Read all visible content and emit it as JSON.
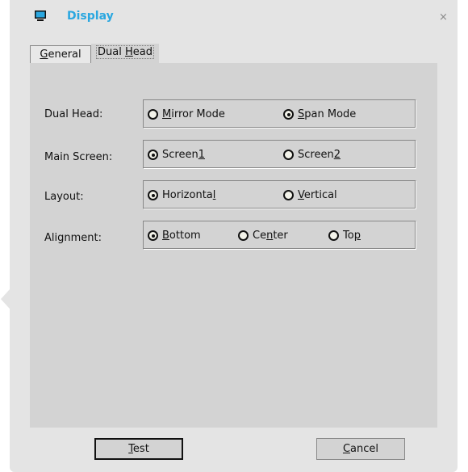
{
  "window": {
    "title": "Display",
    "icon": "monitor-icon",
    "close": "×"
  },
  "tabs": [
    {
      "label": "General",
      "mnemonic": "G",
      "selected": false
    },
    {
      "label": "Dual Head",
      "mnemonic": "H",
      "selected": true
    }
  ],
  "rows": [
    {
      "label": "Dual Head:",
      "options": [
        {
          "label": "Mirror Mode",
          "mnemonic": "M",
          "checked": false
        },
        {
          "label": "Span Mode",
          "mnemonic": "S",
          "checked": true
        }
      ]
    },
    {
      "label": "Main Screen:",
      "options": [
        {
          "label": "Screen1",
          "mnemonic": "1",
          "checked": true
        },
        {
          "label": "Screen2",
          "mnemonic": "2",
          "checked": false
        }
      ]
    },
    {
      "label": "Layout:",
      "options": [
        {
          "label": "Horizontal",
          "mnemonic": "l",
          "checked": true
        },
        {
          "label": "Vertical",
          "mnemonic": "V",
          "checked": false
        }
      ]
    },
    {
      "label": "Alignment:",
      "options": [
        {
          "label": "Bottom",
          "mnemonic": "B",
          "checked": true
        },
        {
          "label": "Center",
          "mnemonic": "n",
          "checked": false
        },
        {
          "label": "Top",
          "mnemonic": "p",
          "checked": false
        }
      ]
    }
  ],
  "buttons": {
    "test": {
      "label": "Test",
      "mnemonic": "T"
    },
    "cancel": {
      "label": "Cancel",
      "mnemonic": "C"
    }
  },
  "colors": {
    "accent": "#2aa7e0"
  }
}
